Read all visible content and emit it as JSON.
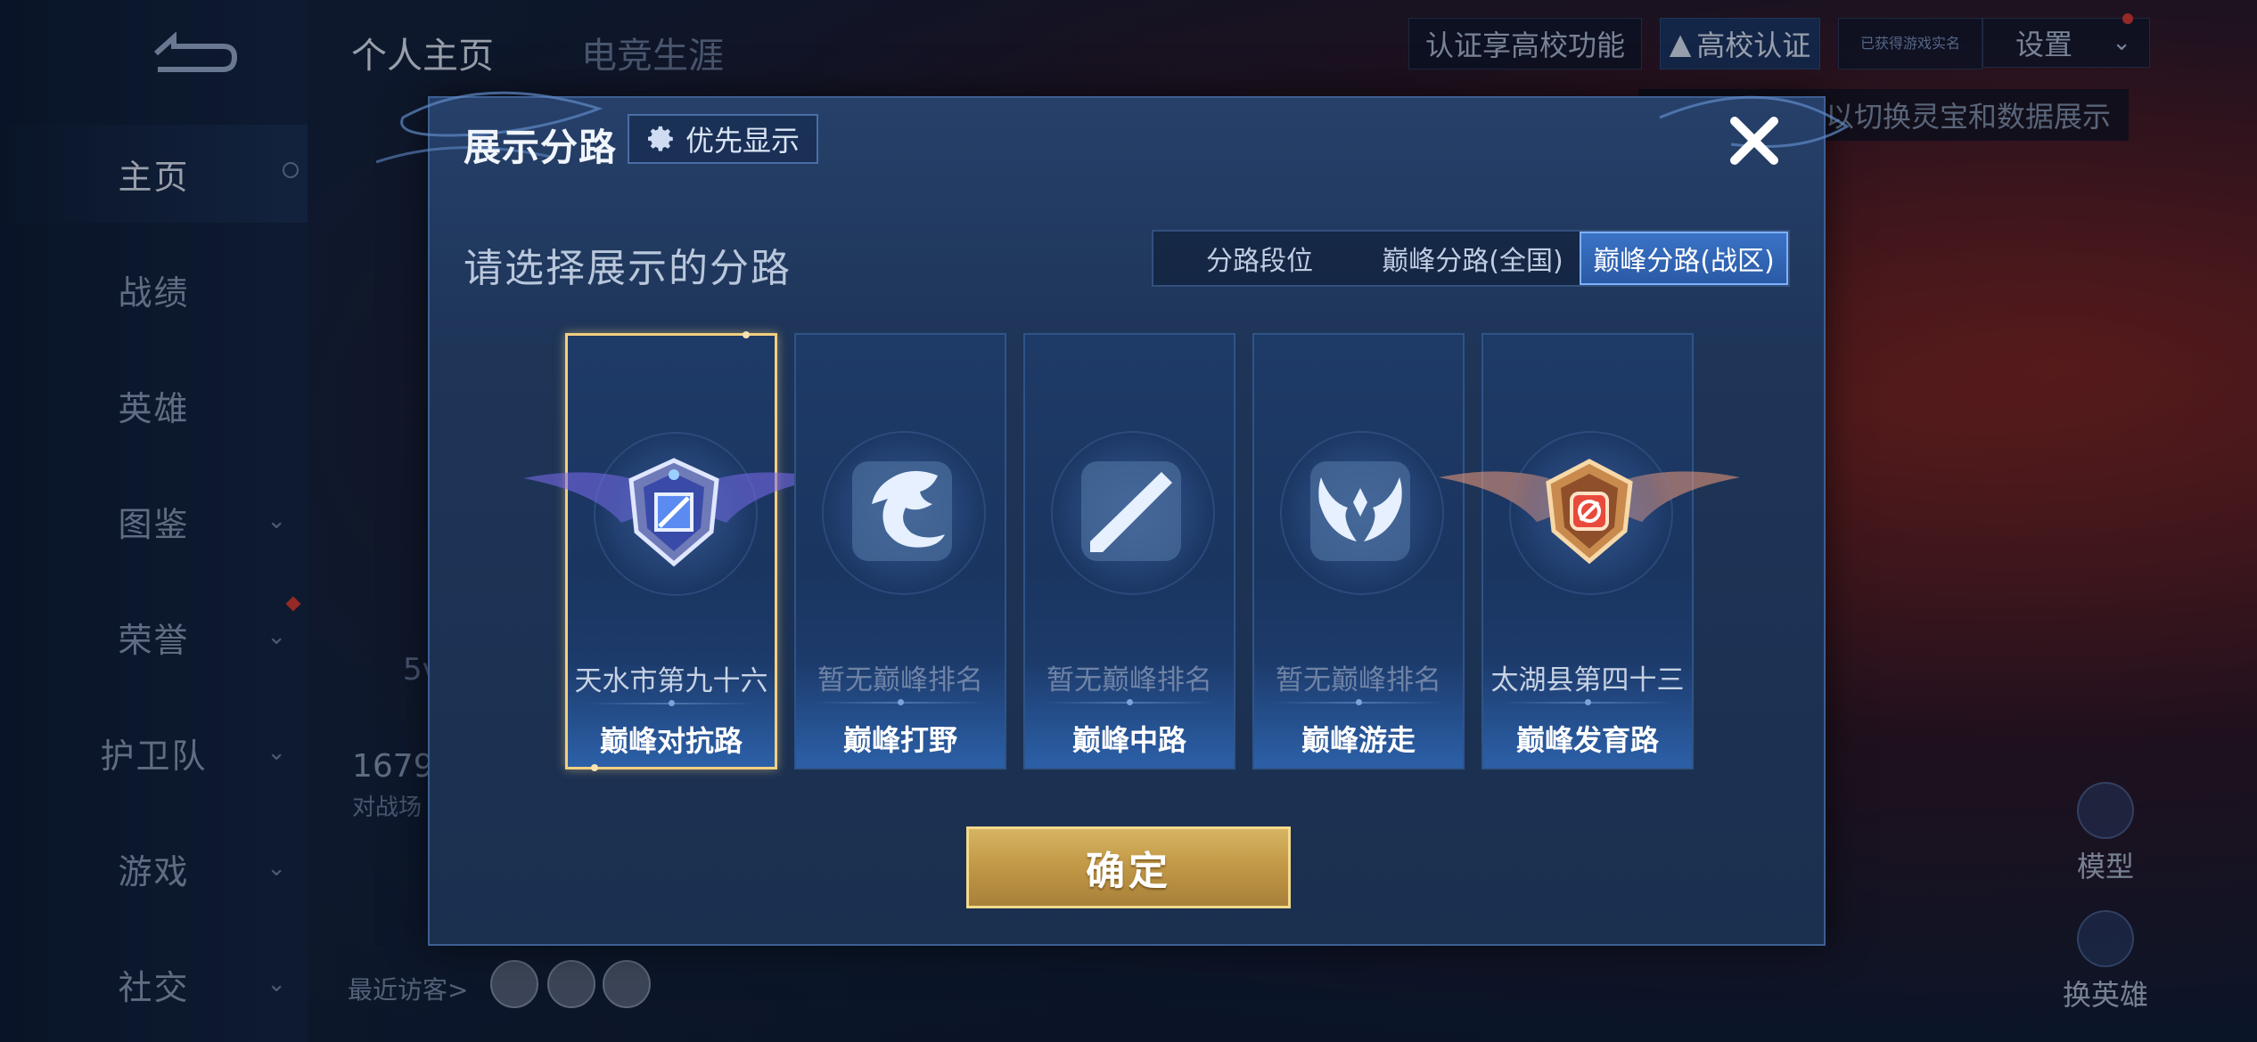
{
  "background": {
    "sidebar": {
      "items": [
        {
          "label": "主页",
          "active": true
        },
        {
          "label": "战绩"
        },
        {
          "label": "英雄"
        },
        {
          "label": "图鉴",
          "has_dropdown": true
        },
        {
          "label": "荣誉",
          "has_dropdown": true,
          "has_alert": true
        },
        {
          "label": "护卫队",
          "has_dropdown": true
        },
        {
          "label": "游戏",
          "has_dropdown": true
        },
        {
          "label": "社交",
          "has_dropdown": true
        }
      ]
    },
    "top_tabs": {
      "home": "个人主页",
      "career": "电竞生涯"
    },
    "topbar": {
      "verify_text": "认证享高校功能",
      "verify_button": "高校认证",
      "badge_line1": "已获得游戏实名",
      "badge_line2": "",
      "settings": "设置"
    },
    "hint": "以切换灵宝和数据展示",
    "stat_number": "1679",
    "stat_label": "对战场",
    "left_partial": "5v",
    "visitors_label": "最近访客>",
    "right_buttons": {
      "model": "模型",
      "switch_hero": "换英雄"
    }
  },
  "modal": {
    "title": "展示分路",
    "priority_button": "优先显示",
    "subtitle": "请选择展示的分路",
    "tabs": [
      {
        "label": "分路段位",
        "active": false
      },
      {
        "label": "巅峰分路(全国)",
        "active": false
      },
      {
        "label": "巅峰分路(战区)",
        "active": true
      }
    ],
    "cards": [
      {
        "rank": "天水市第九十六",
        "role": "巅峰对抗路",
        "icon": "clash-lane-emblem-icon",
        "selected": true,
        "ranked": true
      },
      {
        "rank": "暂无巅峰排名",
        "role": "巅峰打野",
        "icon": "jungle-dragon-icon",
        "selected": false,
        "ranked": false
      },
      {
        "rank": "暂无巅峰排名",
        "role": "巅峰中路",
        "icon": "mid-lane-slash-icon",
        "selected": false,
        "ranked": false
      },
      {
        "rank": "暂无巅峰排名",
        "role": "巅峰游走",
        "icon": "roam-wings-icon",
        "selected": false,
        "ranked": false
      },
      {
        "rank": "太湖县第四十三",
        "role": "巅峰发育路",
        "icon": "farm-lane-emblem-icon",
        "selected": false,
        "ranked": true
      }
    ],
    "confirm_button": "确定"
  },
  "colors": {
    "accent_gold": "#f1cf82",
    "tab_active": "#3b73c5",
    "card_border": "#2f5487"
  }
}
